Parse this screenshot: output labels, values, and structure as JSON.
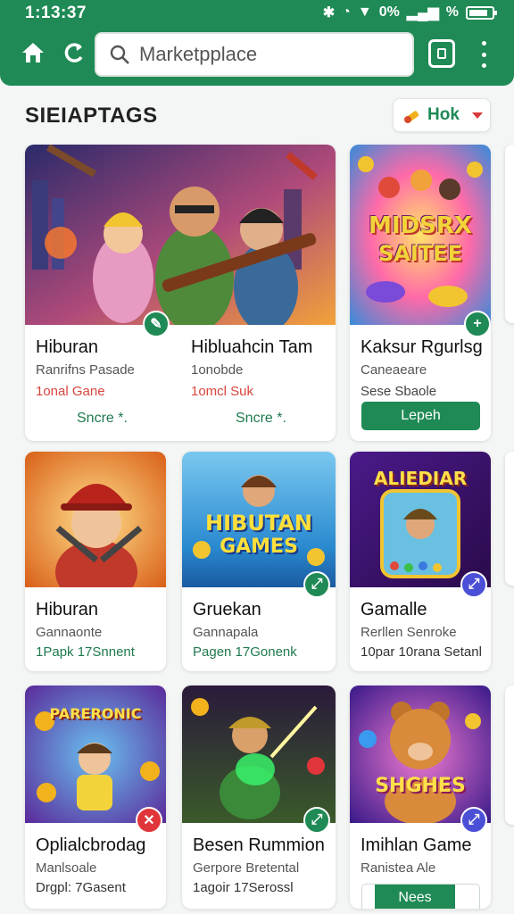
{
  "status_bar": {
    "time": "1:13:37",
    "battery_text": "0%",
    "extra_text": "%"
  },
  "search": {
    "placeholder": "Marketpplace"
  },
  "section": {
    "title": "SIEIAPTAGS",
    "filter_label": "Hok"
  },
  "featured": [
    {
      "title": "Hiburan",
      "subtitle": "Ranrifns Pasade",
      "tag": "1onal Gane",
      "action": "Sncre *."
    },
    {
      "title": "Hibluahcin Tam",
      "subtitle": "1onobde",
      "tag": "1omcl Suk",
      "action": "Sncre *."
    },
    {
      "title": "Kaksur Rgurlsg",
      "subtitle": "Caneaeare",
      "tag": "Sese Sbaole",
      "action": "Lepeh",
      "art_text_1": "MIDSRX",
      "art_text_2": "SAITEE"
    }
  ],
  "row2": [
    {
      "title": "Hiburan",
      "subtitle": "Gannaonte",
      "tag": "1Papk 17Snnent"
    },
    {
      "title": "Gruekan",
      "subtitle": "Gannapala",
      "tag": "Pagen 17Gonenk",
      "art_text_1": "HIBUTAN",
      "art_text_2": "GAMES"
    },
    {
      "title": "Gamalle",
      "subtitle": "Rerllen Senroke",
      "tag": "10par 10rana Setanl",
      "art_text_1": "ALIEDIAR"
    }
  ],
  "row3": [
    {
      "title": "Oplialcbrodag",
      "subtitle": "Manlsoale",
      "tag": "Drgpl: 7Gasent",
      "art_text_1": "PARERONIC"
    },
    {
      "title": "Besen Rummion",
      "subtitle": "Gerpore Bretental",
      "tag": "1agoir 17Serossl"
    },
    {
      "title": "Imihlan Game",
      "subtitle": "Ranistea Ale",
      "action": "Nees",
      "art_text_1": "SHGHES"
    }
  ],
  "colors": {
    "primary": "#1f8a55",
    "tag_red": "#d8453d",
    "badge_blue": "#4a4fd6",
    "badge_red": "#e0353a"
  },
  "icons": [
    "home-icon",
    "refresh-icon",
    "search-icon",
    "tabs-icon",
    "more-vert-icon",
    "edit-badge-icon",
    "plus-badge-icon",
    "link-badge-icon",
    "close-badge-icon"
  ]
}
